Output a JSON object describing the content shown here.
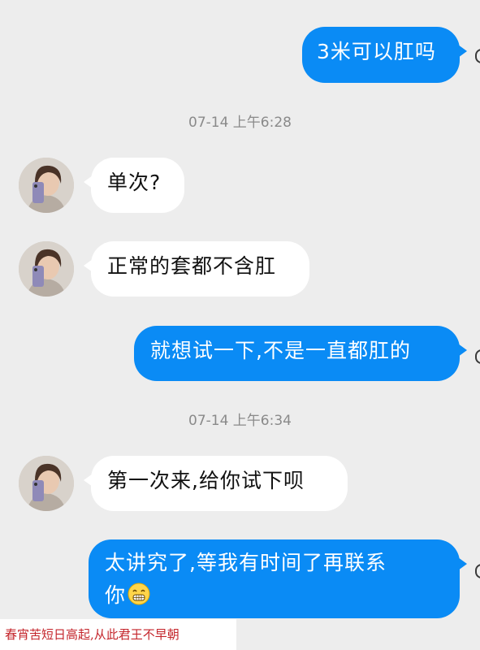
{
  "messages": [
    {
      "side": "out",
      "text": "3米可以肛吗"
    },
    {
      "timestamp": "07-14 上午6:28"
    },
    {
      "side": "in",
      "text": "单次?"
    },
    {
      "side": "in",
      "text": "正常的套都不含肛"
    },
    {
      "side": "out",
      "text": "就想试一下,不是一直都肛的"
    },
    {
      "timestamp": "07-14 上午6:34"
    },
    {
      "side": "in",
      "text": "第一次来,给你试下呗"
    },
    {
      "side": "out",
      "line1": "太讲究了,等我有时间了再联系",
      "line2": "你",
      "emoji": "grinning-face-emoji"
    }
  ],
  "watermark": "春宵苦短日高起,从此君王不早朝",
  "colors": {
    "outgoing_bubble": "#0a8bf5",
    "incoming_bubble": "#ffffff",
    "background": "#ededed",
    "watermark_text": "#c4252b"
  }
}
